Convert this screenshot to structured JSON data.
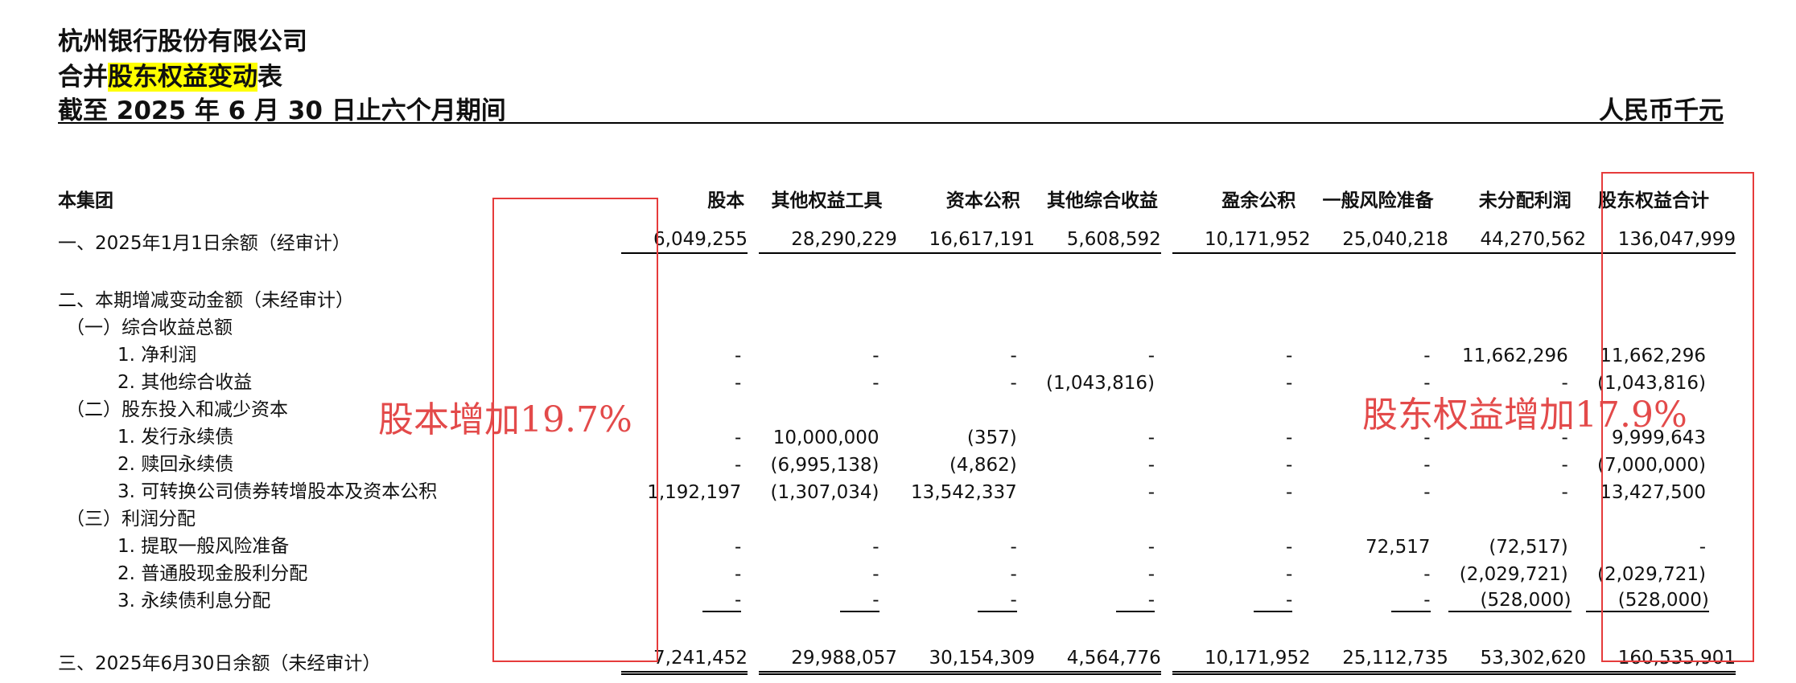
{
  "header": {
    "company": "杭州银行股份有限公司",
    "title_prefix": "合并",
    "title_highlight": "股东权益变动",
    "title_suffix": "表",
    "period": "截至 2025 年 6 月 30 日止六个月期间",
    "unit": "人民币千元"
  },
  "table": {
    "corner": "本集团",
    "columns": [
      "股本",
      "其他权益工具",
      "资本公积",
      "其他综合收益",
      "盈余公积",
      "一般风险准备",
      "未分配利润",
      "股东权益合计"
    ],
    "rows": [
      {
        "label": "一、2025年1月1日余额（经审计）",
        "values": [
          "6,049,255",
          "28,290,229",
          "16,617,191",
          "5,608,592",
          "10,171,952",
          "25,040,218",
          "44,270,562",
          "136,047,999"
        ]
      },
      {
        "label": "二、本期增减变动金额（未经审计）",
        "values": [
          "",
          "",
          "",
          "",
          "",
          "",
          "",
          ""
        ]
      },
      {
        "label": "（一）综合收益总额",
        "values": [
          "",
          "",
          "",
          "",
          "",
          "",
          "",
          ""
        ]
      },
      {
        "label": "1. 净利润",
        "values": [
          "-",
          "-",
          "-",
          "-",
          "-",
          "-",
          "11,662,296",
          "11,662,296"
        ]
      },
      {
        "label": "2. 其他综合收益",
        "values": [
          "-",
          "-",
          "-",
          "(1,043,816)",
          "-",
          "-",
          "-",
          "(1,043,816)"
        ]
      },
      {
        "label": "（二）股东投入和减少资本",
        "values": [
          "",
          "",
          "",
          "",
          "",
          "",
          "",
          ""
        ]
      },
      {
        "label": "1. 发行永续债",
        "values": [
          "-",
          "10,000,000",
          "(357)",
          "-",
          "-",
          "-",
          "-",
          "9,999,643"
        ]
      },
      {
        "label": "2. 赎回永续债",
        "values": [
          "-",
          "(6,995,138)",
          "(4,862)",
          "-",
          "-",
          "-",
          "-",
          "(7,000,000)"
        ]
      },
      {
        "label": "3. 可转换公司债券转增股本及资本公积",
        "values": [
          "1,192,197",
          "(1,307,034)",
          "13,542,337",
          "-",
          "-",
          "-",
          "-",
          "13,427,500"
        ]
      },
      {
        "label": "（三）利润分配",
        "values": [
          "",
          "",
          "",
          "",
          "",
          "",
          "",
          ""
        ]
      },
      {
        "label": "1. 提取一般风险准备",
        "values": [
          "-",
          "-",
          "-",
          "-",
          "-",
          "72,517",
          "(72,517)",
          "-"
        ]
      },
      {
        "label": "2. 普通股现金股利分配",
        "values": [
          "-",
          "-",
          "-",
          "-",
          "-",
          "-",
          "(2,029,721)",
          "(2,029,721)"
        ]
      },
      {
        "label": "3. 永续债利息分配",
        "values": [
          "-",
          "-",
          "-",
          "-",
          "-",
          "-",
          "(528,000)",
          "(528,000)"
        ]
      },
      {
        "label": "三、2025年6月30日余额（未经审计）",
        "values": [
          "7,241,452",
          "29,988,057",
          "30,154,309",
          "4,564,776",
          "10,171,952",
          "25,112,735",
          "53,302,620",
          "160,535,901"
        ]
      }
    ]
  },
  "annotations": {
    "share_capital_note": "股本增加19.7%",
    "equity_note": "股东权益增加17.9%",
    "box_color": "#e63b3b",
    "note_color": "#e34a4a",
    "highlight_color": "#ffff00"
  }
}
